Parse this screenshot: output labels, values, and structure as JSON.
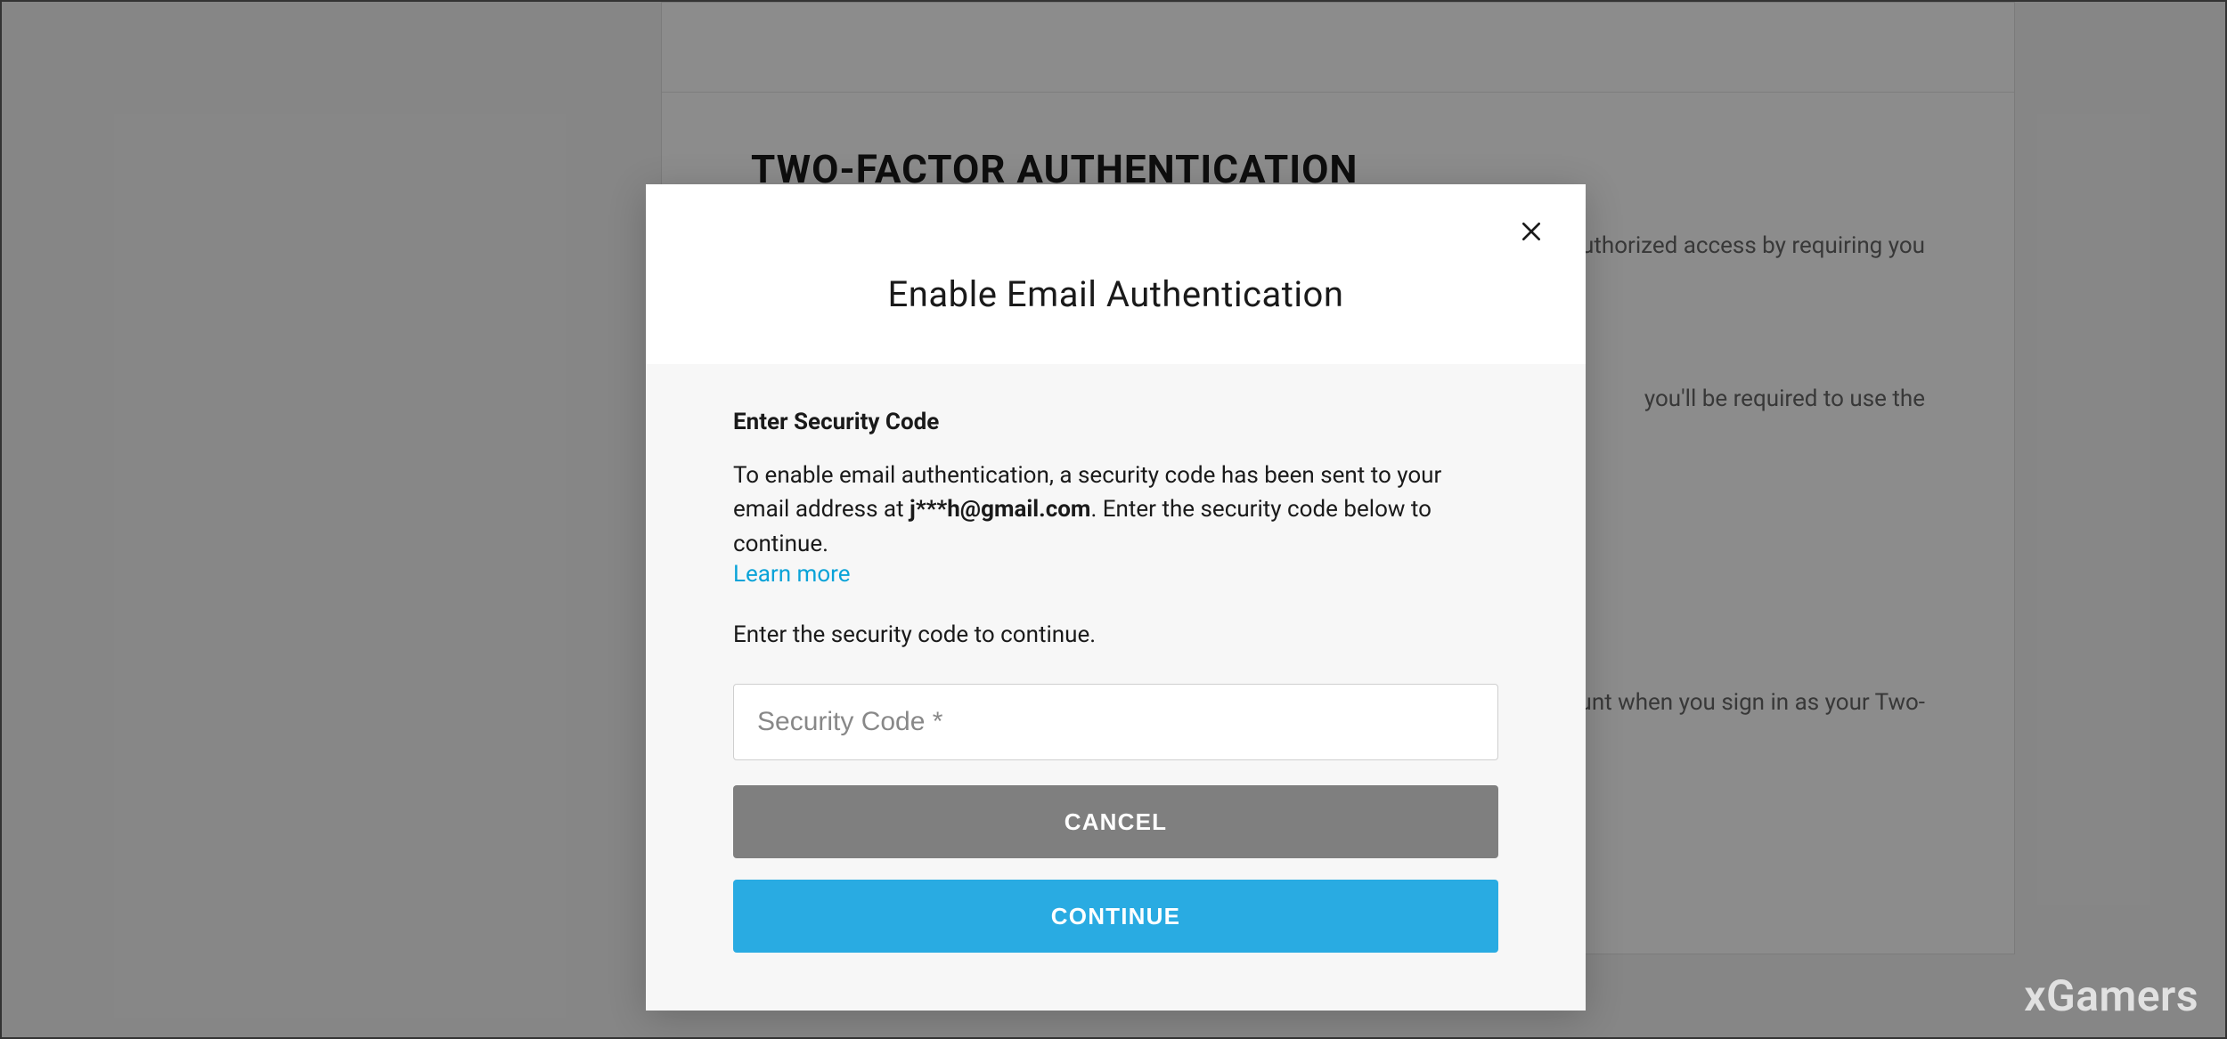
{
  "background": {
    "section_heading": "TWO-FACTOR AUTHENTICATION",
    "line1_fragment": "uthorized access by requiring you",
    "line2_fragment": "you'll be required to use the",
    "line3_fragment": "unt when you sign in as your Two-"
  },
  "modal": {
    "title": "Enable Email Authentication",
    "subheading": "Enter Security Code",
    "description_part1": "To enable email authentication, a security code has been sent to your email address at ",
    "masked_email": "j***h@gmail.com",
    "description_part2": ". Enter the security code below to continue.",
    "learn_more": "Learn more",
    "prompt": "Enter the security code to continue.",
    "input_placeholder": "Security Code *",
    "cancel_label": "CANCEL",
    "continue_label": "CONTINUE"
  },
  "watermark": "xGamers"
}
